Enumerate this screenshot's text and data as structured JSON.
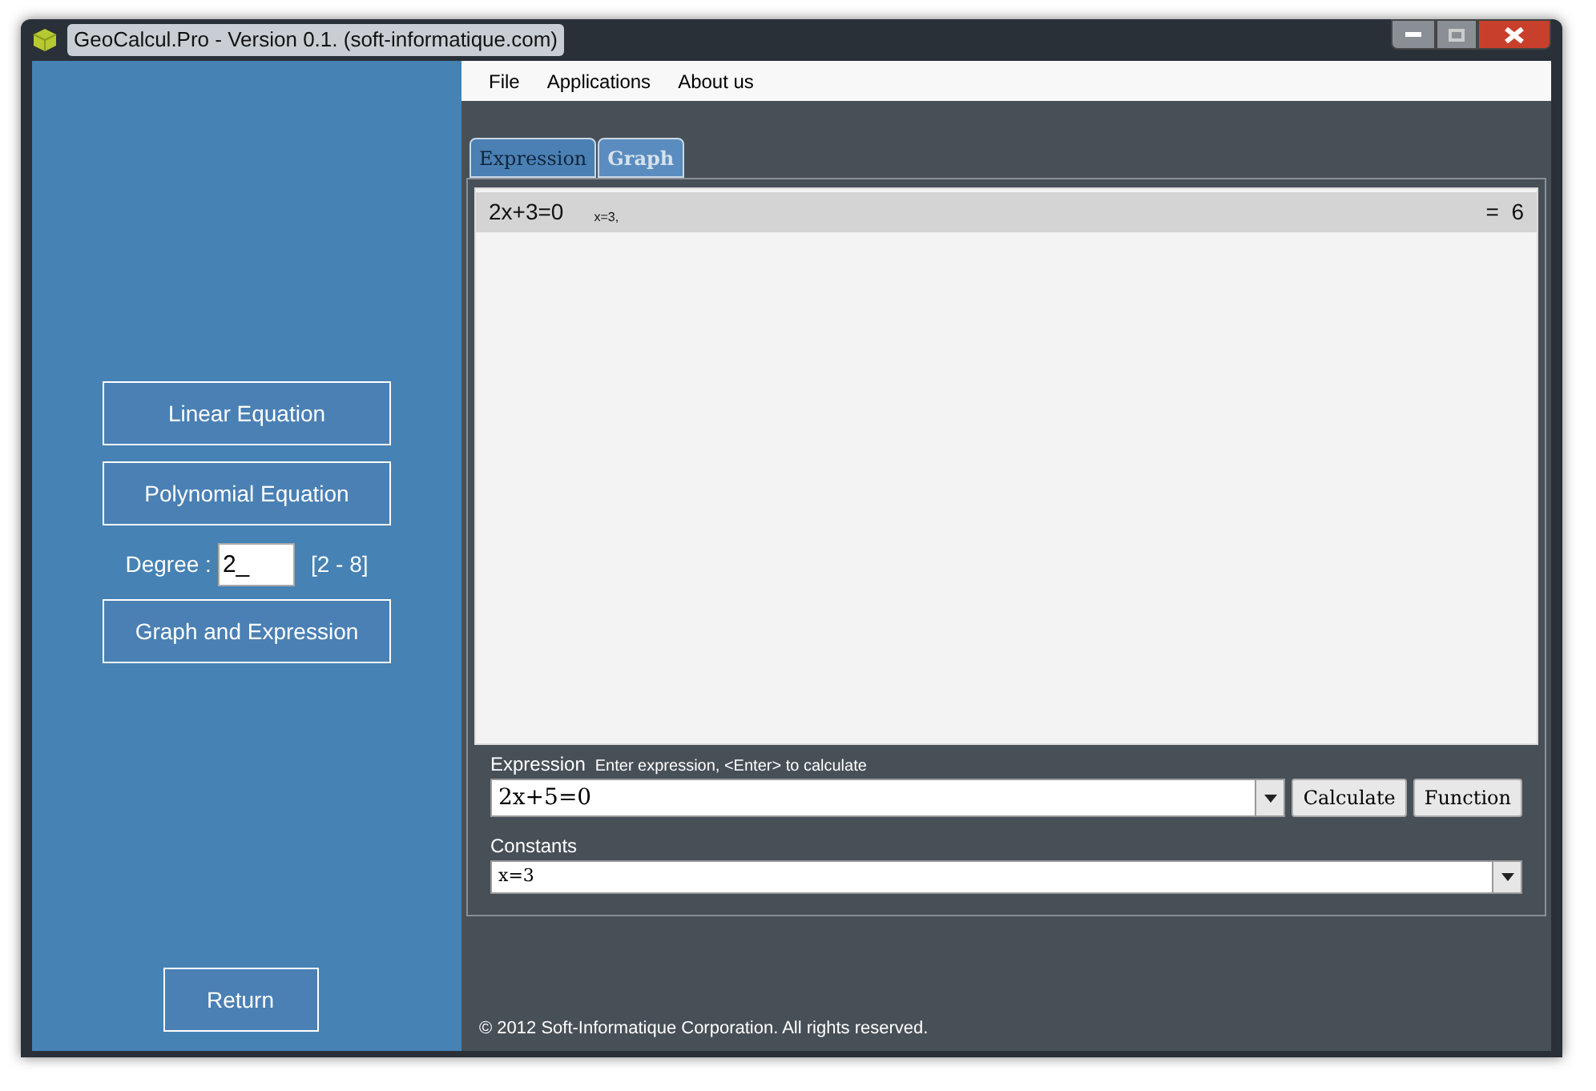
{
  "window": {
    "title": "GeoCalcul.Pro - Version 0.1. (soft-informatique.com)"
  },
  "sidebar": {
    "buttons": [
      "Linear Equation",
      "Polynomial Equation"
    ],
    "degree": {
      "label": "Degree :",
      "value": "2_",
      "range": "[2 - 8]"
    },
    "graph_button": "Graph and Expression",
    "return_button": "Return"
  },
  "menu": [
    "File",
    "Applications",
    "About us"
  ],
  "tabs": [
    {
      "label": "Expression",
      "selected": true
    },
    {
      "label": "Graph",
      "selected": false
    }
  ],
  "results": [
    {
      "expression": "2x+3=0",
      "constants": "x=3,",
      "result": "=  6",
      "selected": true
    }
  ],
  "expression": {
    "label": "Expression",
    "hint": "Enter expression, <Enter> to calculate",
    "value": "2x+5=0"
  },
  "buttons": [
    "Calculate",
    "Function"
  ],
  "constants": {
    "label": "Constants",
    "value": "x=3"
  },
  "footer": "© 2012 Soft-Informatique Corporation. All rights reserved."
}
